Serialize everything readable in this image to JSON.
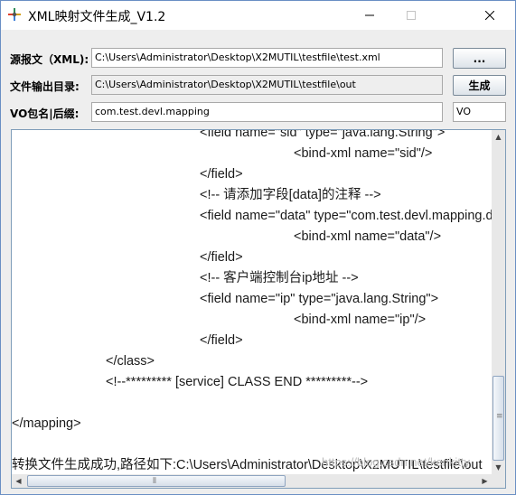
{
  "window": {
    "title": "XML映射文件生成_V1.2",
    "icons": {
      "app": "dandelion-app-icon",
      "minimize": "minimize-icon",
      "maximize": "maximize-icon",
      "close": "close-icon"
    }
  },
  "form": {
    "source_label": "源报文（XML):",
    "source_value": "C:\\Users\\Administrator\\Desktop\\X2MUTIL\\testfile\\test.xml",
    "browse_label": "...",
    "output_label": "文件输出目录:",
    "output_value": "C:\\Users\\Administrator\\Desktop\\X2MUTIL\\testfile\\out",
    "generate_label": "生成",
    "package_label": "VO包名|后缀:",
    "package_value": "com.test.devl.mapping",
    "suffix_value": "VO"
  },
  "output": {
    "lines": [
      {
        "indent": 208,
        "text": "<field name=\"sid\" type=\"java.lang.String\">"
      },
      {
        "indent": 312,
        "text": "<bind-xml name=\"sid\"/>"
      },
      {
        "indent": 208,
        "text": "</field>"
      },
      {
        "indent": 208,
        "text": "<!-- 请添加字段[data]的注释 -->"
      },
      {
        "indent": 208,
        "text": "<field name=\"data\" type=\"com.test.devl.mapping.data\">"
      },
      {
        "indent": 312,
        "text": "<bind-xml name=\"data\"/>"
      },
      {
        "indent": 208,
        "text": "</field>"
      },
      {
        "indent": 208,
        "text": "<!-- 客户端控制台ip地址 -->"
      },
      {
        "indent": 208,
        "text": "<field name=\"ip\" type=\"java.lang.String\">"
      },
      {
        "indent": 312,
        "text": "<bind-xml name=\"ip\"/>"
      },
      {
        "indent": 208,
        "text": "</field>"
      },
      {
        "indent": 104,
        "text": "</class>"
      },
      {
        "indent": 104,
        "text": "<!--********* [service] CLASS END *********-->"
      },
      {
        "indent": 0,
        "text": ""
      },
      {
        "indent": 0,
        "text": "</mapping>"
      },
      {
        "indent": 0,
        "text": ""
      },
      {
        "indent": 0,
        "text": "转换文件生成成功,路径如下:C:\\Users\\Administrator\\Desktop\\X2MUTIL\\testfile\\out"
      }
    ],
    "vertical_scroll_fraction": 0.92,
    "horizontal_scroll_fraction": 0.0
  },
  "watermark": "https://blog.csdn.net/kenkitty"
}
